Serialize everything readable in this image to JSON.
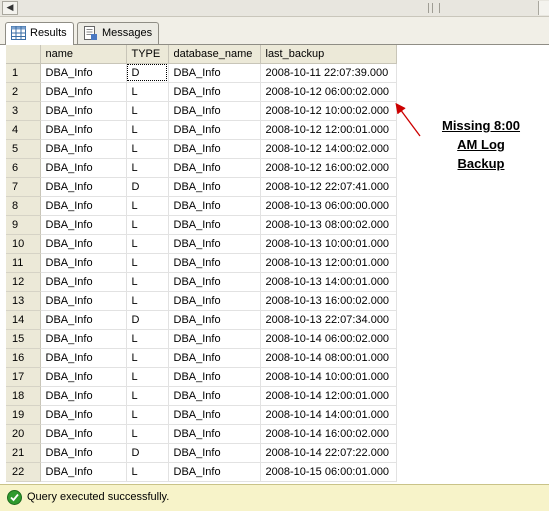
{
  "tabs": [
    {
      "label": "Results",
      "icon": "grid-icon",
      "active": true
    },
    {
      "label": "Messages",
      "icon": "messages-icon",
      "active": false
    }
  ],
  "grid": {
    "columns": [
      "",
      "name",
      "TYPE",
      "database_name",
      "last_backup"
    ],
    "rows": [
      [
        "1",
        "DBA_Info",
        "D",
        "DBA_Info",
        "2008-10-11 22:07:39.000"
      ],
      [
        "2",
        "DBA_Info",
        "L",
        "DBA_Info",
        "2008-10-12 06:00:02.000"
      ],
      [
        "3",
        "DBA_Info",
        "L",
        "DBA_Info",
        "2008-10-12 10:00:02.000"
      ],
      [
        "4",
        "DBA_Info",
        "L",
        "DBA_Info",
        "2008-10-12 12:00:01.000"
      ],
      [
        "5",
        "DBA_Info",
        "L",
        "DBA_Info",
        "2008-10-12 14:00:02.000"
      ],
      [
        "6",
        "DBA_Info",
        "L",
        "DBA_Info",
        "2008-10-12 16:00:02.000"
      ],
      [
        "7",
        "DBA_Info",
        "D",
        "DBA_Info",
        "2008-10-12 22:07:41.000"
      ],
      [
        "8",
        "DBA_Info",
        "L",
        "DBA_Info",
        "2008-10-13 06:00:00.000"
      ],
      [
        "9",
        "DBA_Info",
        "L",
        "DBA_Info",
        "2008-10-13 08:00:02.000"
      ],
      [
        "10",
        "DBA_Info",
        "L",
        "DBA_Info",
        "2008-10-13 10:00:01.000"
      ],
      [
        "11",
        "DBA_Info",
        "L",
        "DBA_Info",
        "2008-10-13 12:00:01.000"
      ],
      [
        "12",
        "DBA_Info",
        "L",
        "DBA_Info",
        "2008-10-13 14:00:01.000"
      ],
      [
        "13",
        "DBA_Info",
        "L",
        "DBA_Info",
        "2008-10-13 16:00:02.000"
      ],
      [
        "14",
        "DBA_Info",
        "D",
        "DBA_Info",
        "2008-10-13 22:07:34.000"
      ],
      [
        "15",
        "DBA_Info",
        "L",
        "DBA_Info",
        "2008-10-14 06:00:02.000"
      ],
      [
        "16",
        "DBA_Info",
        "L",
        "DBA_Info",
        "2008-10-14 08:00:01.000"
      ],
      [
        "17",
        "DBA_Info",
        "L",
        "DBA_Info",
        "2008-10-14 10:00:01.000"
      ],
      [
        "18",
        "DBA_Info",
        "L",
        "DBA_Info",
        "2008-10-14 12:00:01.000"
      ],
      [
        "19",
        "DBA_Info",
        "L",
        "DBA_Info",
        "2008-10-14 14:00:01.000"
      ],
      [
        "20",
        "DBA_Info",
        "L",
        "DBA_Info",
        "2008-10-14 16:00:02.000"
      ],
      [
        "21",
        "DBA_Info",
        "D",
        "DBA_Info",
        "2008-10-14 22:07:22.000"
      ],
      [
        "22",
        "DBA_Info",
        "L",
        "DBA_Info",
        "2008-10-15 06:00:01.000"
      ]
    ]
  },
  "annotation": {
    "lines": [
      "Missing 8:00",
      "AM Log",
      "Backup"
    ],
    "color": "#cc0000"
  },
  "status": {
    "message": "Query executed successfully.",
    "icon": "check-circle-icon",
    "color": "#f7f3c9"
  },
  "colors": {
    "header_bg": "#ece9d8",
    "grid_line": "#e2e2e2",
    "arrow": "#cc0000",
    "status_ok": "#2f9a2f"
  }
}
